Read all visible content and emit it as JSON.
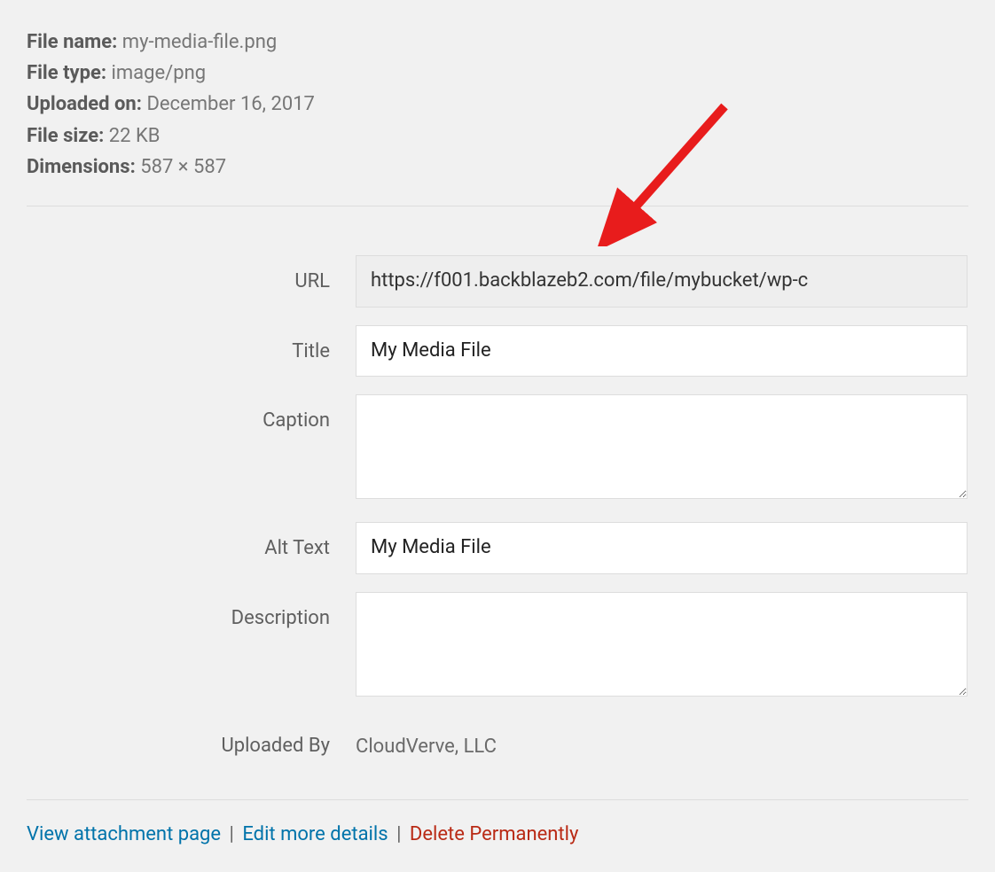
{
  "meta": {
    "file_name_label": "File name:",
    "file_name_value": "my-media-file.png",
    "file_type_label": "File type:",
    "file_type_value": "image/png",
    "uploaded_on_label": "Uploaded on:",
    "uploaded_on_value": "December 16, 2017",
    "file_size_label": "File size:",
    "file_size_value": "22 KB",
    "dimensions_label": "Dimensions:",
    "dimensions_value": "587 × 587"
  },
  "form": {
    "url_label": "URL",
    "url_value": "https://f001.backblazeb2.com/file/mybucket/wp-c",
    "title_label": "Title",
    "title_value": "My Media File",
    "caption_label": "Caption",
    "caption_value": "",
    "alt_text_label": "Alt Text",
    "alt_text_value": "My Media File",
    "description_label": "Description",
    "description_value": "",
    "uploaded_by_label": "Uploaded By",
    "uploaded_by_value": "CloudVerve, LLC"
  },
  "actions": {
    "view_attachment_label": "View attachment page",
    "edit_details_label": "Edit more details",
    "delete_label": "Delete Permanently",
    "separator": " | "
  }
}
